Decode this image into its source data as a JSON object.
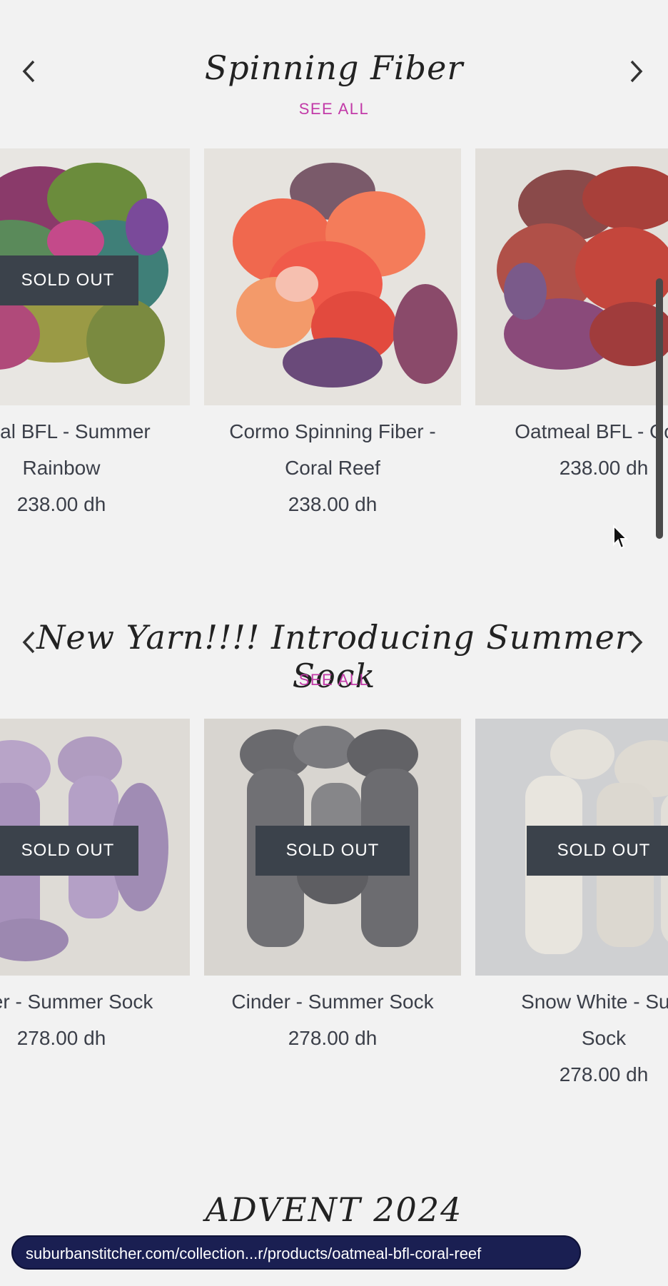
{
  "spinning": {
    "title": "Spinning Fiber",
    "see_all": "SEE ALL",
    "products": [
      {
        "name_line1": "meal BFL - Summer",
        "name_line2": "Rainbow",
        "price": "238.00 dh",
        "badge": "SOLD OUT"
      },
      {
        "name_line1": "Cormo Spinning Fiber -",
        "name_line2": "Coral Reef",
        "price": "238.00 dh",
        "badge": ""
      },
      {
        "name_line1": "Oatmeal BFL - Cora",
        "name_line2": "",
        "price": "238.00 dh",
        "badge": ""
      }
    ]
  },
  "summer_sock": {
    "title": "New Yarn!!!! Introducing Summer Sock",
    "see_all": "SEE ALL",
    "products": [
      {
        "name_line1": "nder - Summer Sock",
        "name_line2": "",
        "price": "278.00 dh",
        "badge": "SOLD OUT"
      },
      {
        "name_line1": "Cinder - Summer Sock",
        "name_line2": "",
        "price": "278.00 dh",
        "badge": "SOLD OUT"
      },
      {
        "name_line1": "Snow White - Sum",
        "name_line2": "Sock",
        "price": "278.00 dh",
        "badge": "SOLD OUT"
      }
    ]
  },
  "advent": {
    "title": "ADVENT 2024"
  },
  "status_bar": {
    "url": "suburbanstitcher.com/collection...r/products/oatmeal-bfl-coral-reef"
  },
  "icons": {
    "prev": "chevron-left-icon",
    "next": "chevron-right-icon",
    "cursor": "mouse-pointer-icon"
  },
  "colors": {
    "accent": "#c23aa8",
    "badge_bg": "#3b424b",
    "page_bg": "#f2f2f2",
    "status_bg": "#1a1f52"
  }
}
